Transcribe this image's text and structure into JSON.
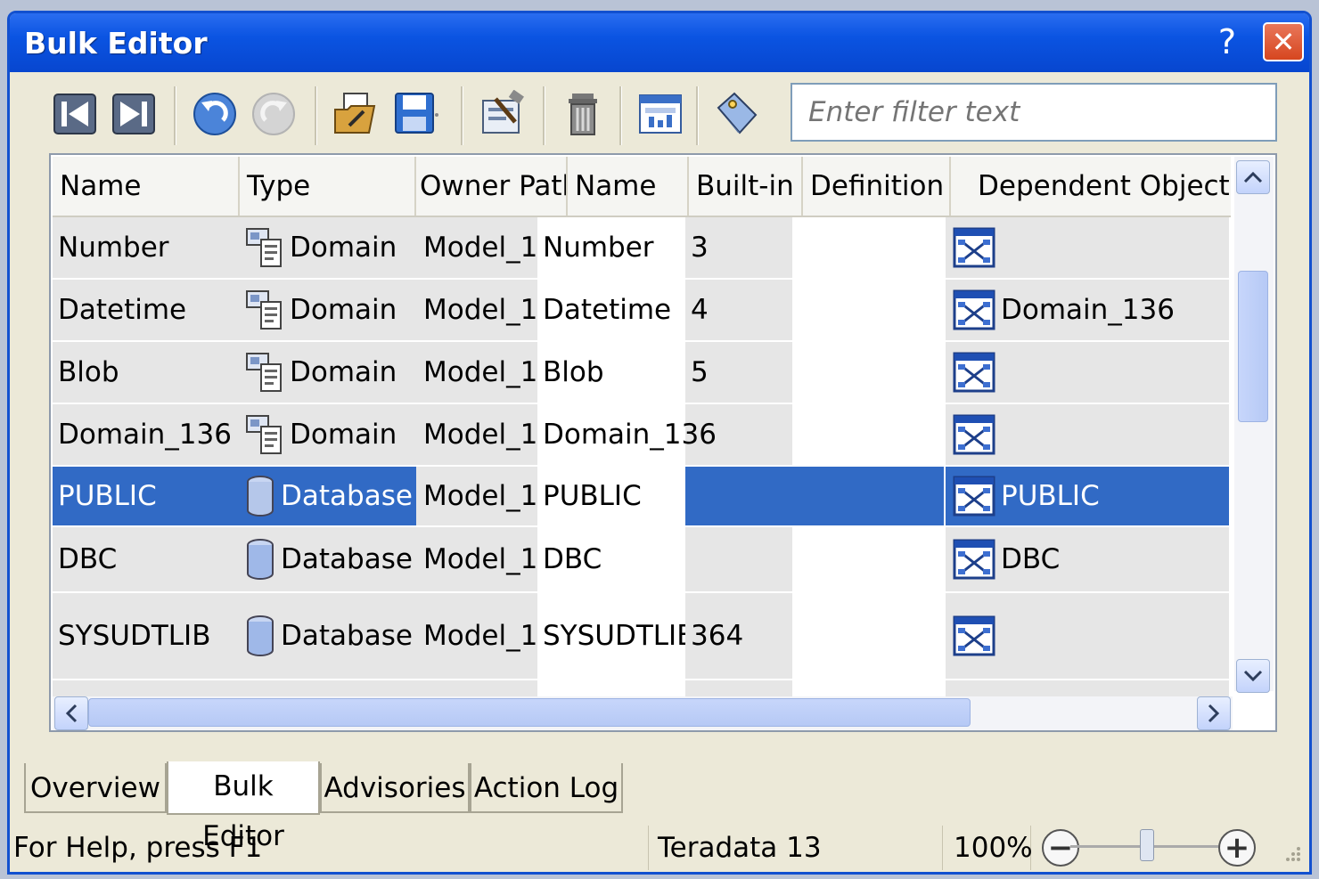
{
  "window": {
    "title": "Bulk Editor",
    "help_label": "?",
    "close_label": "✕"
  },
  "filter": {
    "placeholder": "Enter filter text"
  },
  "toolbar": {
    "icons": [
      "previous-icon",
      "next-icon",
      "undo-icon",
      "redo-icon",
      "open-icon",
      "save-icon",
      "edit-properties-icon",
      "delete-icon",
      "report-icon",
      "tag-icon"
    ]
  },
  "grid": {
    "columns": [
      "Name",
      "Type",
      "Owner Path",
      "Name",
      "Built-in Id",
      "Definition",
      "Dependent Objects"
    ],
    "rows": [
      {
        "name": "Number",
        "type": "Domain",
        "owner_path": "Model_1",
        "name2": "Number",
        "builtin_id": "3",
        "definition": "",
        "dependent": ""
      },
      {
        "name": "Datetime",
        "type": "Domain",
        "owner_path": "Model_1",
        "name2": "Datetime",
        "builtin_id": "4",
        "definition": "",
        "dependent": "Domain_136"
      },
      {
        "name": "Blob",
        "type": "Domain",
        "owner_path": "Model_1",
        "name2": "Blob",
        "builtin_id": "5",
        "definition": "",
        "dependent": ""
      },
      {
        "name": "Domain_136",
        "type": "Domain",
        "owner_path": "Model_1",
        "name2": "Domain_136",
        "builtin_id": "",
        "definition": "",
        "dependent": ""
      },
      {
        "name": "PUBLIC",
        "type": "Database",
        "owner_path": "Model_1",
        "name2": "PUBLIC",
        "builtin_id": "",
        "definition": "",
        "dependent": "PUBLIC"
      },
      {
        "name": "DBC",
        "type": "Database",
        "owner_path": "Model_1",
        "name2": "DBC",
        "builtin_id": "",
        "definition": "",
        "dependent": "DBC"
      },
      {
        "name": "SYSUDTLIB",
        "type": "Database",
        "owner_path": "Model_1",
        "name2": "SYSUDTLIB",
        "builtin_id": "364",
        "definition": "",
        "dependent": ""
      }
    ]
  },
  "tabs": [
    "Overview",
    "Bulk Editor",
    "Advisories",
    "Action Log"
  ],
  "status": {
    "help": "For Help, press F1",
    "db": "Teradata 13",
    "zoom": "100%",
    "zoom_out": "−",
    "zoom_in": "+"
  },
  "colors": {
    "selection": "#316ac5",
    "title_bar": "#0b54e2"
  }
}
